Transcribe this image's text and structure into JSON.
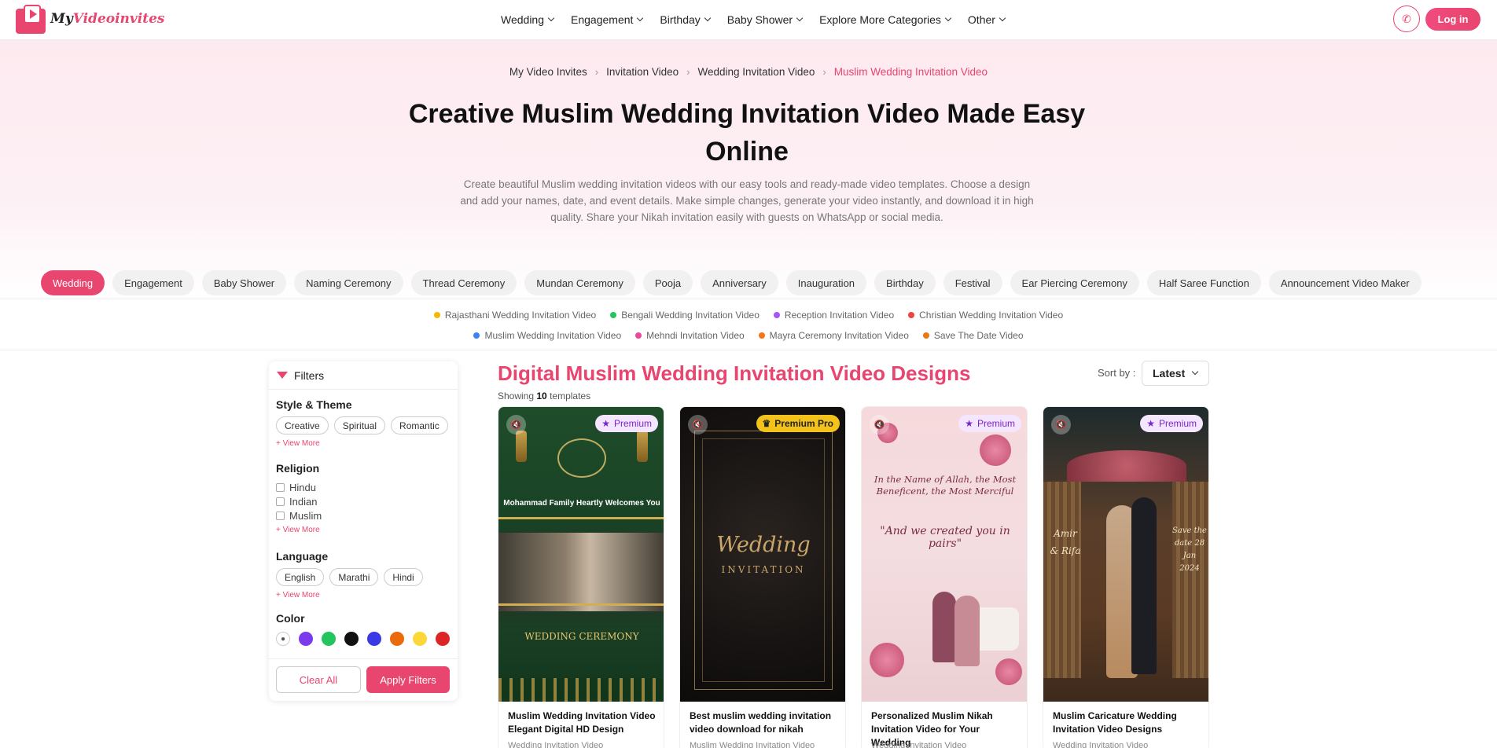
{
  "brand": {
    "name_prefix": "My",
    "name_main": "Videoinvites"
  },
  "nav": [
    {
      "label": "Wedding"
    },
    {
      "label": "Engagement"
    },
    {
      "label": "Birthday"
    },
    {
      "label": "Baby Shower"
    },
    {
      "label": "Explore More Categories"
    },
    {
      "label": "Other"
    }
  ],
  "header": {
    "login_label": "Log in"
  },
  "breadcrumb": [
    "My Video Invites",
    "Invitation Video",
    "Wedding Invitation Video",
    "Muslim Wedding Invitation Video"
  ],
  "hero": {
    "title": "Creative Muslim Wedding Invitation Video Made Easy Online",
    "description": "Create beautiful Muslim wedding invitation videos with our easy tools and ready-made video templates. Choose a design and add your names, date, and event details. Make simple changes, generate your video instantly, and download it in high quality. Share your Nikah invitation easily with guests on WhatsApp or social media."
  },
  "categories": [
    "Wedding",
    "Engagement",
    "Baby Shower",
    "Naming Ceremony",
    "Thread Ceremony",
    "Mundan Ceremony",
    "Pooja",
    "Anniversary",
    "Inauguration",
    "Birthday",
    "Festival",
    "Ear Piercing Ceremony",
    "Half Saree Function",
    "Announcement Video Maker"
  ],
  "active_category": "Wedding",
  "subcategories_row1": [
    {
      "label": "Rajasthani Wedding Invitation Video",
      "color": "#f5b800"
    },
    {
      "label": "Bengali Wedding Invitation Video",
      "color": "#22c55e"
    },
    {
      "label": "Reception Invitation Video",
      "color": "#a855f7"
    },
    {
      "label": "Christian Wedding Invitation Video",
      "color": "#ef4444"
    }
  ],
  "subcategories_row2": [
    {
      "label": "Muslim Wedding Invitation Video",
      "color": "#3b82f6"
    },
    {
      "label": "Mehndi Invitation Video",
      "color": "#ec4899"
    },
    {
      "label": "Mayra Ceremony Invitation Video",
      "color": "#f97316"
    },
    {
      "label": "Save The Date Video",
      "color": "#ea7a0c"
    }
  ],
  "filters": {
    "title": "Filters",
    "style_title": "Style & Theme",
    "style_chips": [
      "Creative",
      "Spiritual",
      "Romantic"
    ],
    "religion_title": "Religion",
    "religions": [
      "Hindu",
      "Indian",
      "Muslim"
    ],
    "language_title": "Language",
    "languages": [
      "English",
      "Marathi",
      "Hindi"
    ],
    "color_title": "Color",
    "colors": [
      "#7c3aed",
      "#22c55e",
      "#111111",
      "#3b38e6",
      "#ea6a0c",
      "#fbd838",
      "#dc2626"
    ],
    "view_more": "+ View More",
    "clear_label": "Clear All",
    "apply_label": "Apply Filters"
  },
  "results": {
    "title": "Digital Muslim Wedding Invitation Video Designs",
    "showing_prefix": "Showing",
    "count": "10",
    "showing_suffix": "templates",
    "sort_label": "Sort by :",
    "sort_value": "Latest"
  },
  "cards": [
    {
      "badge": "Premium",
      "title": "Muslim Wedding Invitation Video Elegant Digital HD Design",
      "category": "Wedding Invitation Video",
      "art_line": "Mohammad Family Heartly Welcomes You",
      "art_ceremony": "WEDDING CEREMONY"
    },
    {
      "badge": "Premium Pro",
      "title": "Best muslim wedding invitation video download for nikah",
      "category": "Muslim Wedding Invitation Video",
      "art_word": "Wedding",
      "art_sub": "INVITATION"
    },
    {
      "badge": "Premium",
      "title": "Personalized Muslim Nikah Invitation Video for Your Wedding",
      "category": "Wedding Invitation Video",
      "art_lines": "In the Name of Allah, the Most Beneficent, the Most Merciful",
      "art_quote": "\"And we created you in pairs\""
    },
    {
      "badge": "Premium",
      "title": "Muslim Caricature Wedding Invitation Video Designs",
      "category": "Wedding Invitation Video",
      "art_names": "Amir & Rifa",
      "art_save": "Save the date 28 Jan 2024"
    }
  ],
  "icons": {
    "phone": "phone-icon",
    "filter": "filter-icon",
    "mute": "mute-icon",
    "star": "star-icon",
    "crown": "crown-icon",
    "palette": "palette-icon"
  }
}
